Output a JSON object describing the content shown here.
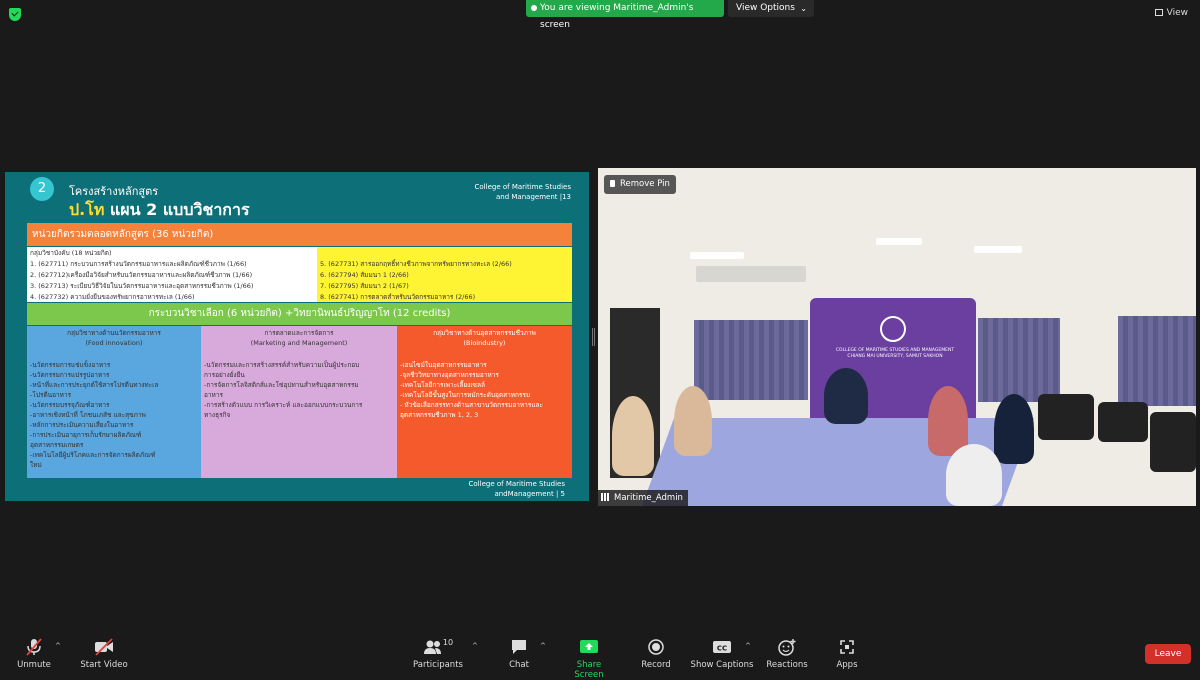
{
  "topbar": {
    "viewing_text": "You are viewing Maritime_Admin's screen",
    "view_options": "View Options",
    "view": "View"
  },
  "slide": {
    "number": "2",
    "title": "โครงสร้างหลักสูตร",
    "college_line1": "College of Maritime Studies",
    "college_line2": "and Management |13",
    "heading_yellow": "ป.โท",
    "heading_white": " แผน 2 แบบวิชาการ",
    "total_bar": "หน่วยกิตรวมตลอดหลักสูตร (36 หน่วยกิต)",
    "core_left": [
      "กลุ่มวิชาบังคับ (18 หน่วยกิต)",
      "1. (627711) กระบวนการสร้างนวัตกรรมอาหารและผลิตภัณฑ์ชีวภาพ (1/66)",
      "2. (627712)เครื่องมือวิจัยสำหรับนวัตกรรมอาหารและผลิตภัณฑ์ชีวภาพ (1/66)",
      "3. (627713) ระเบียบวิธีวิจัยในนวัตกรรมอาหารและอุตสาหกรรมชีวภาพ (1/66)",
      "4. (627732) ความยั่งยืนของทรัพยากรอาหารทะเล (1/66)"
    ],
    "core_right": [
      "5. (627731) สารออกฤทธิ์ทางชีวภาพจากทรัพยากรทางทะเล (2/66)",
      "6. (627794) สัมมนา 1 (2/66)",
      "7. (627795) สัมมนา 2 (1/67)",
      "8. (627741) การตลาดสำหรับนวัตกรรมอาหาร (2/66)"
    ],
    "elective_bar": "กระบวนวิชาเลือก (6 หน่วยกิต) +วิทยานิพนธ์ปริญญาโท (12 credits)",
    "col1_head1": "กลุ่มวิชาทางด้านนวัตกรรมอาหาร",
    "col1_head2": "(Food innovation)",
    "col1_items": [
      "-นวัตกรรมการแช่แข็งอาหาร",
      "-นวัตกรรมการแปรรูปอาหาร",
      "-หน้าที่และการประยุกต์ใช้สารโปรตีนทางทะเล",
      "-โปรตีนอาหาร",
      "-นวัตกรรมบรรจุภัณฑ์อาหาร",
      "-อาหารเชิงหน้าที่ โภชนเภสัช และสุขภาพ",
      "-หลักการประเมินความเสี่ยงในอาหาร",
      "-การประเมินอายุการเก็บรักษาผลิตภัณฑ์",
      "อุตสาหกรรมเกษตร",
      "-เทคโนโลยีผู้บริโภคและการจัดการผลิตภัณฑ์",
      "ใหม่"
    ],
    "col2_head1": "การตลาดและการจัดการ",
    "col2_head2": "(Marketing and Management)",
    "col2_items": [
      "-นวัตกรรมและการสร้างสรรค์สำหรับความเป็นผู้ประกอบ",
      "การอย่างยั่งยืน",
      "-การจัดการโลจิสติกส์และโซ่อุปทานสำหรับอุตสาหกรรม",
      "อาหาร",
      "-การสร้างตัวแบบ การวิเคราะห์ และออกแบบกระบวนการ",
      "ทางธุรกิจ"
    ],
    "col3_head1": "กลุ่มวิชาทางด้านอุตสาหกรรมชีวภาพ",
    "col3_head2": "(Bioindustry)",
    "col3_items": [
      "-เอนไซม์ในอุตสาหกรรมอาหาร",
      "-จุลชีววิทยาทางอุตสาหกรรมอาหาร",
      "-เทคโนโลยีการเพาะเลี้ยงเซลล์",
      "-เทคโนโลยีขั้นสูงในการหมักระดับอุตสาหกรรม",
      "- หัวข้อเลือกสรรทางด้านสาขานวัตกรรมอาหารและ",
      "อุตสาหกรรมชีวภาพ 1, 2, 3"
    ],
    "footer_line1": "College of Maritime Studies",
    "footer_line2": "andManagement | 5"
  },
  "video": {
    "remove_pin": "Remove Pin",
    "participant_name": "Maritime_Admin",
    "banner_text": "COLLEGE OF MARITIME STUDIES AND MANAGEMENT CHIANG MAI UNIVERSITY, SAMUT SAKHON"
  },
  "toolbar": {
    "unmute": "Unmute",
    "start_video": "Start Video",
    "participants": "Participants",
    "participants_count": "10",
    "chat": "Chat",
    "share_screen": "Share Screen",
    "record": "Record",
    "show_captions": "Show Captions",
    "reactions": "Reactions",
    "apps": "Apps",
    "leave": "Leave"
  },
  "colors": {
    "share_green": "#23d959",
    "leave_red": "#d33029",
    "slide_teal": "#0d6f78"
  }
}
